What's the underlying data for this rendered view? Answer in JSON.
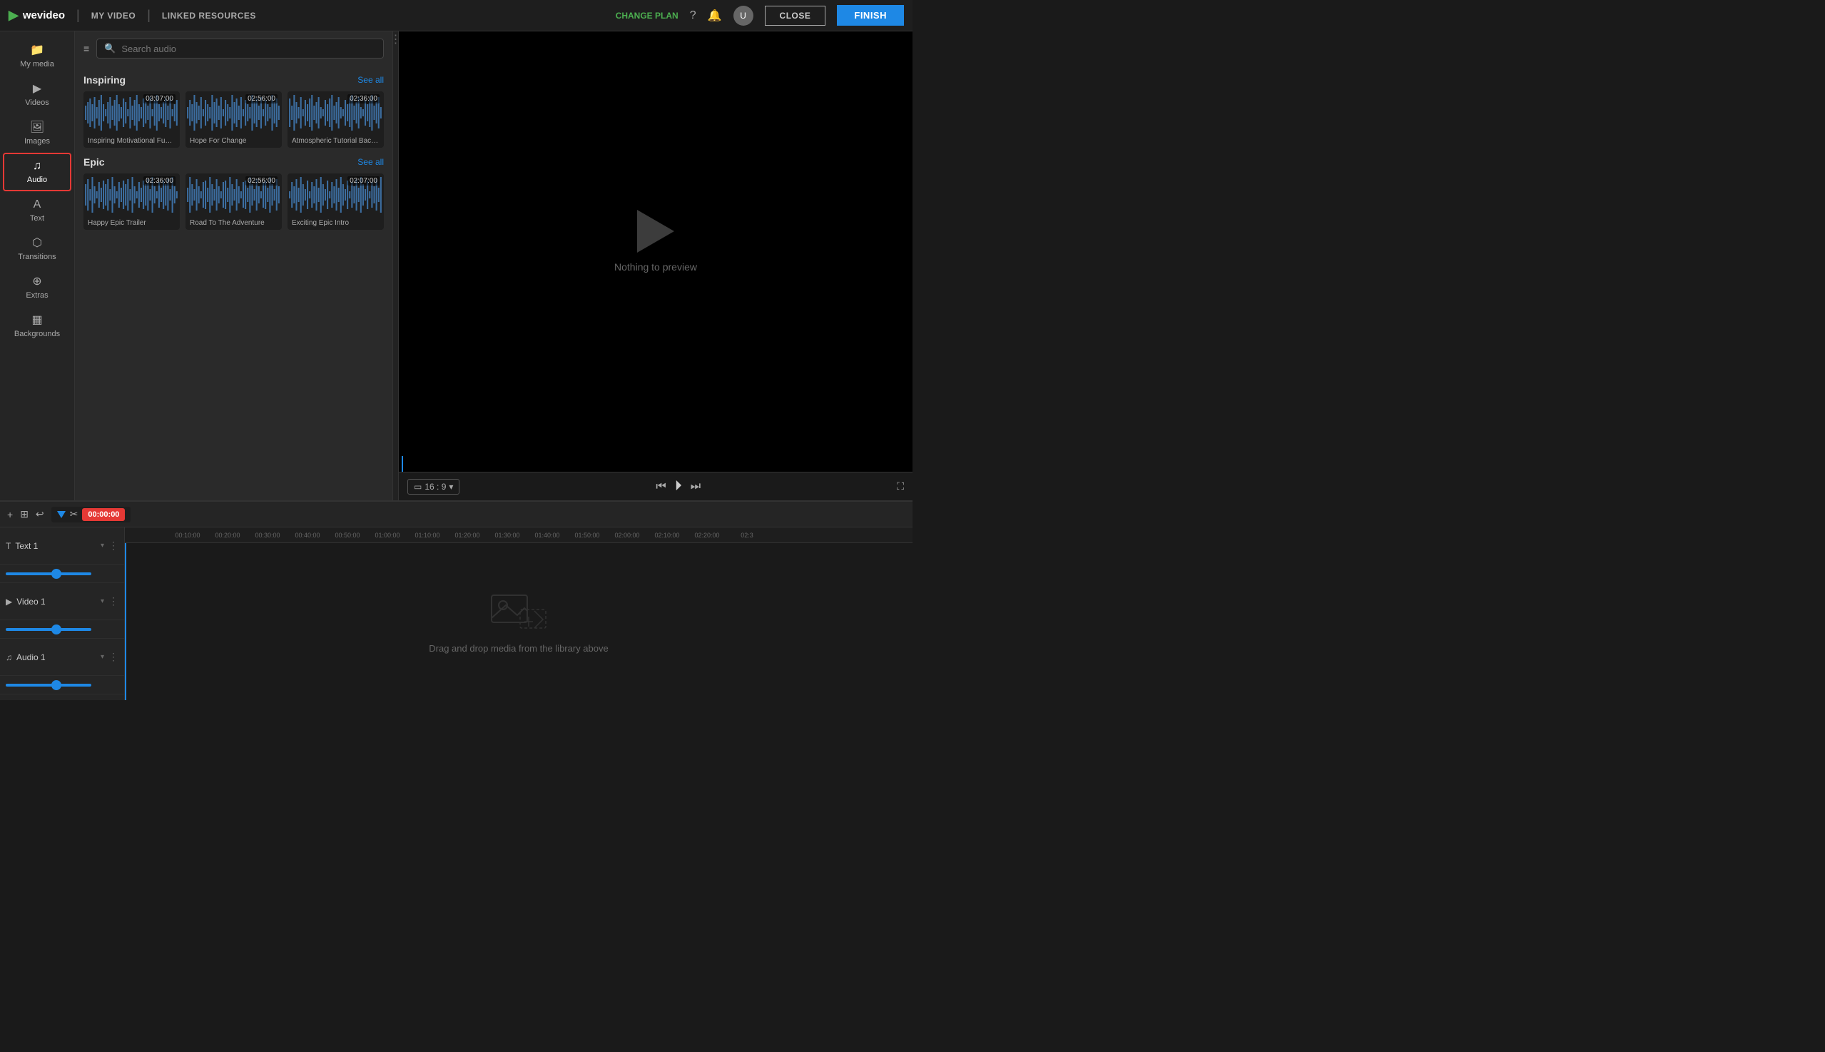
{
  "app": {
    "logo_text": "wevideo",
    "change_plan": "CHANGE PLAN",
    "close_btn": "CLOSE",
    "finish_btn": "FINISH"
  },
  "nav": {
    "tabs": [
      {
        "label": "MY VIDEO"
      },
      {
        "label": "LINKED RESOURCES"
      }
    ]
  },
  "sidebar": {
    "items": [
      {
        "label": "My media",
        "icon": "📁"
      },
      {
        "label": "Videos",
        "icon": "▶"
      },
      {
        "label": "Images",
        "icon": "🖼"
      },
      {
        "label": "Audio",
        "icon": "♫",
        "active": true
      },
      {
        "label": "Text",
        "icon": "A"
      },
      {
        "label": "Transitions",
        "icon": "⬡"
      },
      {
        "label": "Extras",
        "icon": "⊕"
      },
      {
        "label": "Backgrounds",
        "icon": "▦"
      }
    ]
  },
  "audio_panel": {
    "search_placeholder": "Search audio",
    "sections": [
      {
        "title": "Inspiring",
        "see_all": "See all",
        "tracks": [
          {
            "time": "03:07:00",
            "title": "Inspiring Motivational Fundraise..."
          },
          {
            "time": "02:56:00",
            "title": "Hope For Change"
          },
          {
            "time": "02:36:00",
            "title": "Atmospheric Tutorial Background"
          }
        ]
      },
      {
        "title": "Epic",
        "see_all": "See all",
        "tracks": [
          {
            "time": "02:36:00",
            "title": "Happy Epic Trailer"
          },
          {
            "time": "02:56:00",
            "title": "Road To The Adventure"
          },
          {
            "time": "02:07:00",
            "title": "Exciting Epic Intro"
          }
        ]
      }
    ]
  },
  "preview": {
    "nothing_text": "Nothing to preview",
    "aspect_ratio": "16 : 9"
  },
  "timeline": {
    "time_display": "00:00:00",
    "ruler": [
      "00:10:00",
      "00:20:00",
      "00:30:00",
      "00:40:00",
      "00:50:00",
      "01:00:00",
      "01:10:00",
      "01:20:00",
      "01:30:00",
      "01:40:00",
      "01:50:00",
      "02:00:00",
      "02:10:00",
      "02:20:00",
      "02:3"
    ],
    "tracks": [
      {
        "name": "Text 1",
        "icon": "T"
      },
      {
        "name": "Video 1",
        "icon": "▶"
      },
      {
        "name": "Audio 1",
        "icon": "♫"
      }
    ],
    "drop_text": "Drag and drop media from the library above"
  }
}
